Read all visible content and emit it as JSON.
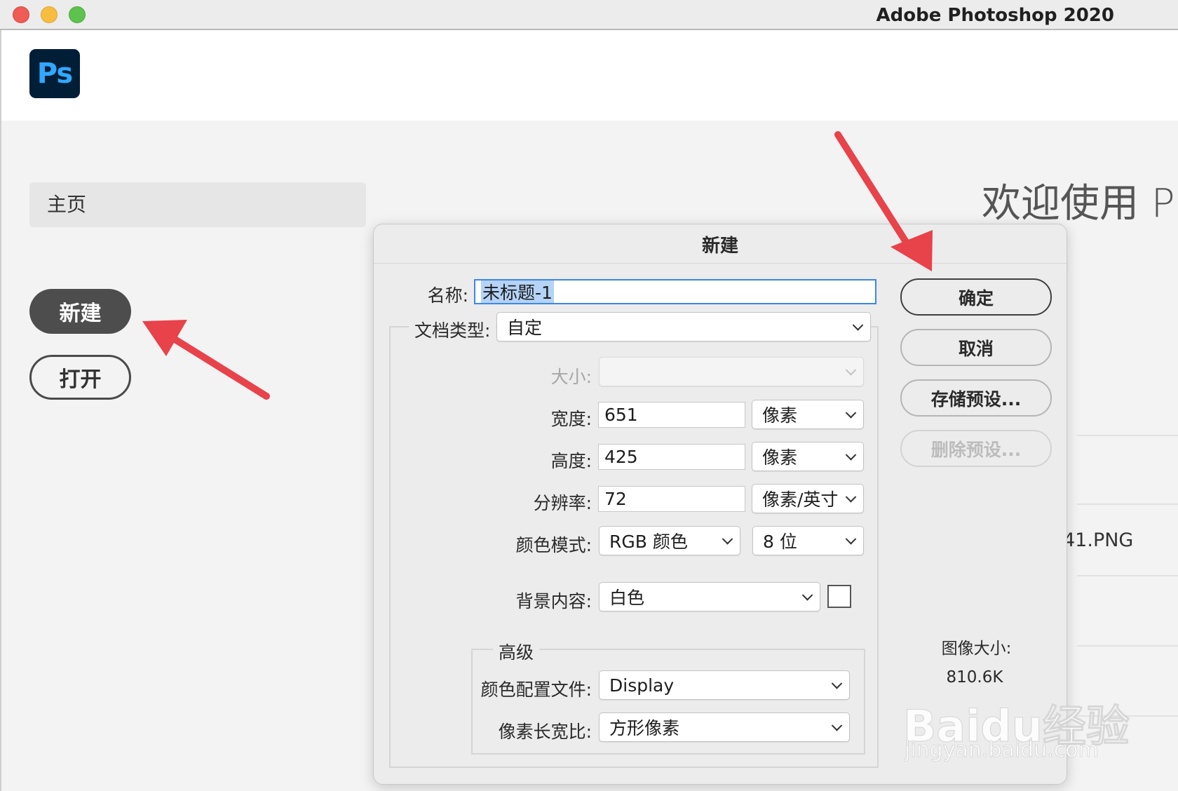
{
  "window": {
    "title": "Adobe Photoshop 2020"
  },
  "app": {
    "logo_text": "Ps"
  },
  "sidebar": {
    "home_label": "主页",
    "new_button": "新建",
    "open_button": "打开"
  },
  "background": {
    "welcome_text": "欢迎使用 Ph",
    "recent_file": "41.PNG"
  },
  "dialog": {
    "title": "新建",
    "name_label": "名称:",
    "name_value": "未标题-1",
    "doc_type_label": "文档类型:",
    "doc_type_value": "自定",
    "size_label": "大小:",
    "size_value": "",
    "width_label": "宽度:",
    "width_value": "651",
    "width_unit": "像素",
    "height_label": "高度:",
    "height_value": "425",
    "height_unit": "像素",
    "resolution_label": "分辨率:",
    "resolution_value": "72",
    "resolution_unit": "像素/英寸",
    "color_mode_label": "颜色模式:",
    "color_mode_value": "RGB 颜色",
    "bit_depth_value": "8 位",
    "background_label": "背景内容:",
    "background_value": "白色",
    "background_swatch_color": "#ffffff",
    "advanced_legend": "高级",
    "color_profile_label": "颜色配置文件:",
    "color_profile_value": "Display",
    "pixel_aspect_label": "像素长宽比:",
    "pixel_aspect_value": "方形像素",
    "buttons": {
      "ok": "确定",
      "cancel": "取消",
      "save_preset": "存储预设...",
      "delete_preset": "删除预设..."
    },
    "image_size_label": "图像大小:",
    "image_size_value": "810.6K"
  },
  "watermark": {
    "brand": "Baidu经验",
    "url": "jingyan.baidu.com"
  },
  "colors": {
    "annotation_arrow": "#e8424a",
    "accent_focus": "#3d86e8",
    "ps_logo_bg": "#001e36",
    "ps_logo_fg": "#31a8ff"
  }
}
